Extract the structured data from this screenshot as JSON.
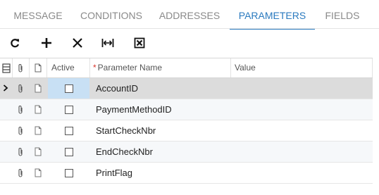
{
  "tabs": [
    {
      "label": "MESSAGE",
      "active": false
    },
    {
      "label": "CONDITIONS",
      "active": false
    },
    {
      "label": "ADDRESSES",
      "active": false
    },
    {
      "label": "PARAMETERS",
      "active": true
    },
    {
      "label": "FIELDS",
      "active": false
    }
  ],
  "toolbar": {
    "buttons": [
      "refresh-icon",
      "add-icon",
      "delete-icon",
      "fit-columns-icon",
      "export-excel-icon"
    ]
  },
  "grid": {
    "columns": {
      "active": "Active",
      "required_marker": "*",
      "parameter_name": "Parameter Name",
      "value": "Value"
    },
    "rows": [
      {
        "active": false,
        "parameter_name": "AccountID",
        "value": "",
        "selected": true
      },
      {
        "active": false,
        "parameter_name": "PaymentMethodID",
        "value": "",
        "selected": false
      },
      {
        "active": false,
        "parameter_name": "StartCheckNbr",
        "value": "",
        "selected": false
      },
      {
        "active": false,
        "parameter_name": "EndCheckNbr",
        "value": "",
        "selected": false
      },
      {
        "active": false,
        "parameter_name": "PrintFlag",
        "value": "",
        "selected": false
      }
    ]
  },
  "colors": {
    "accent": "#2a7abf",
    "selected_row": "#dcdcdc",
    "active_cell": "#c8e0f4",
    "required": "#d9342b"
  }
}
